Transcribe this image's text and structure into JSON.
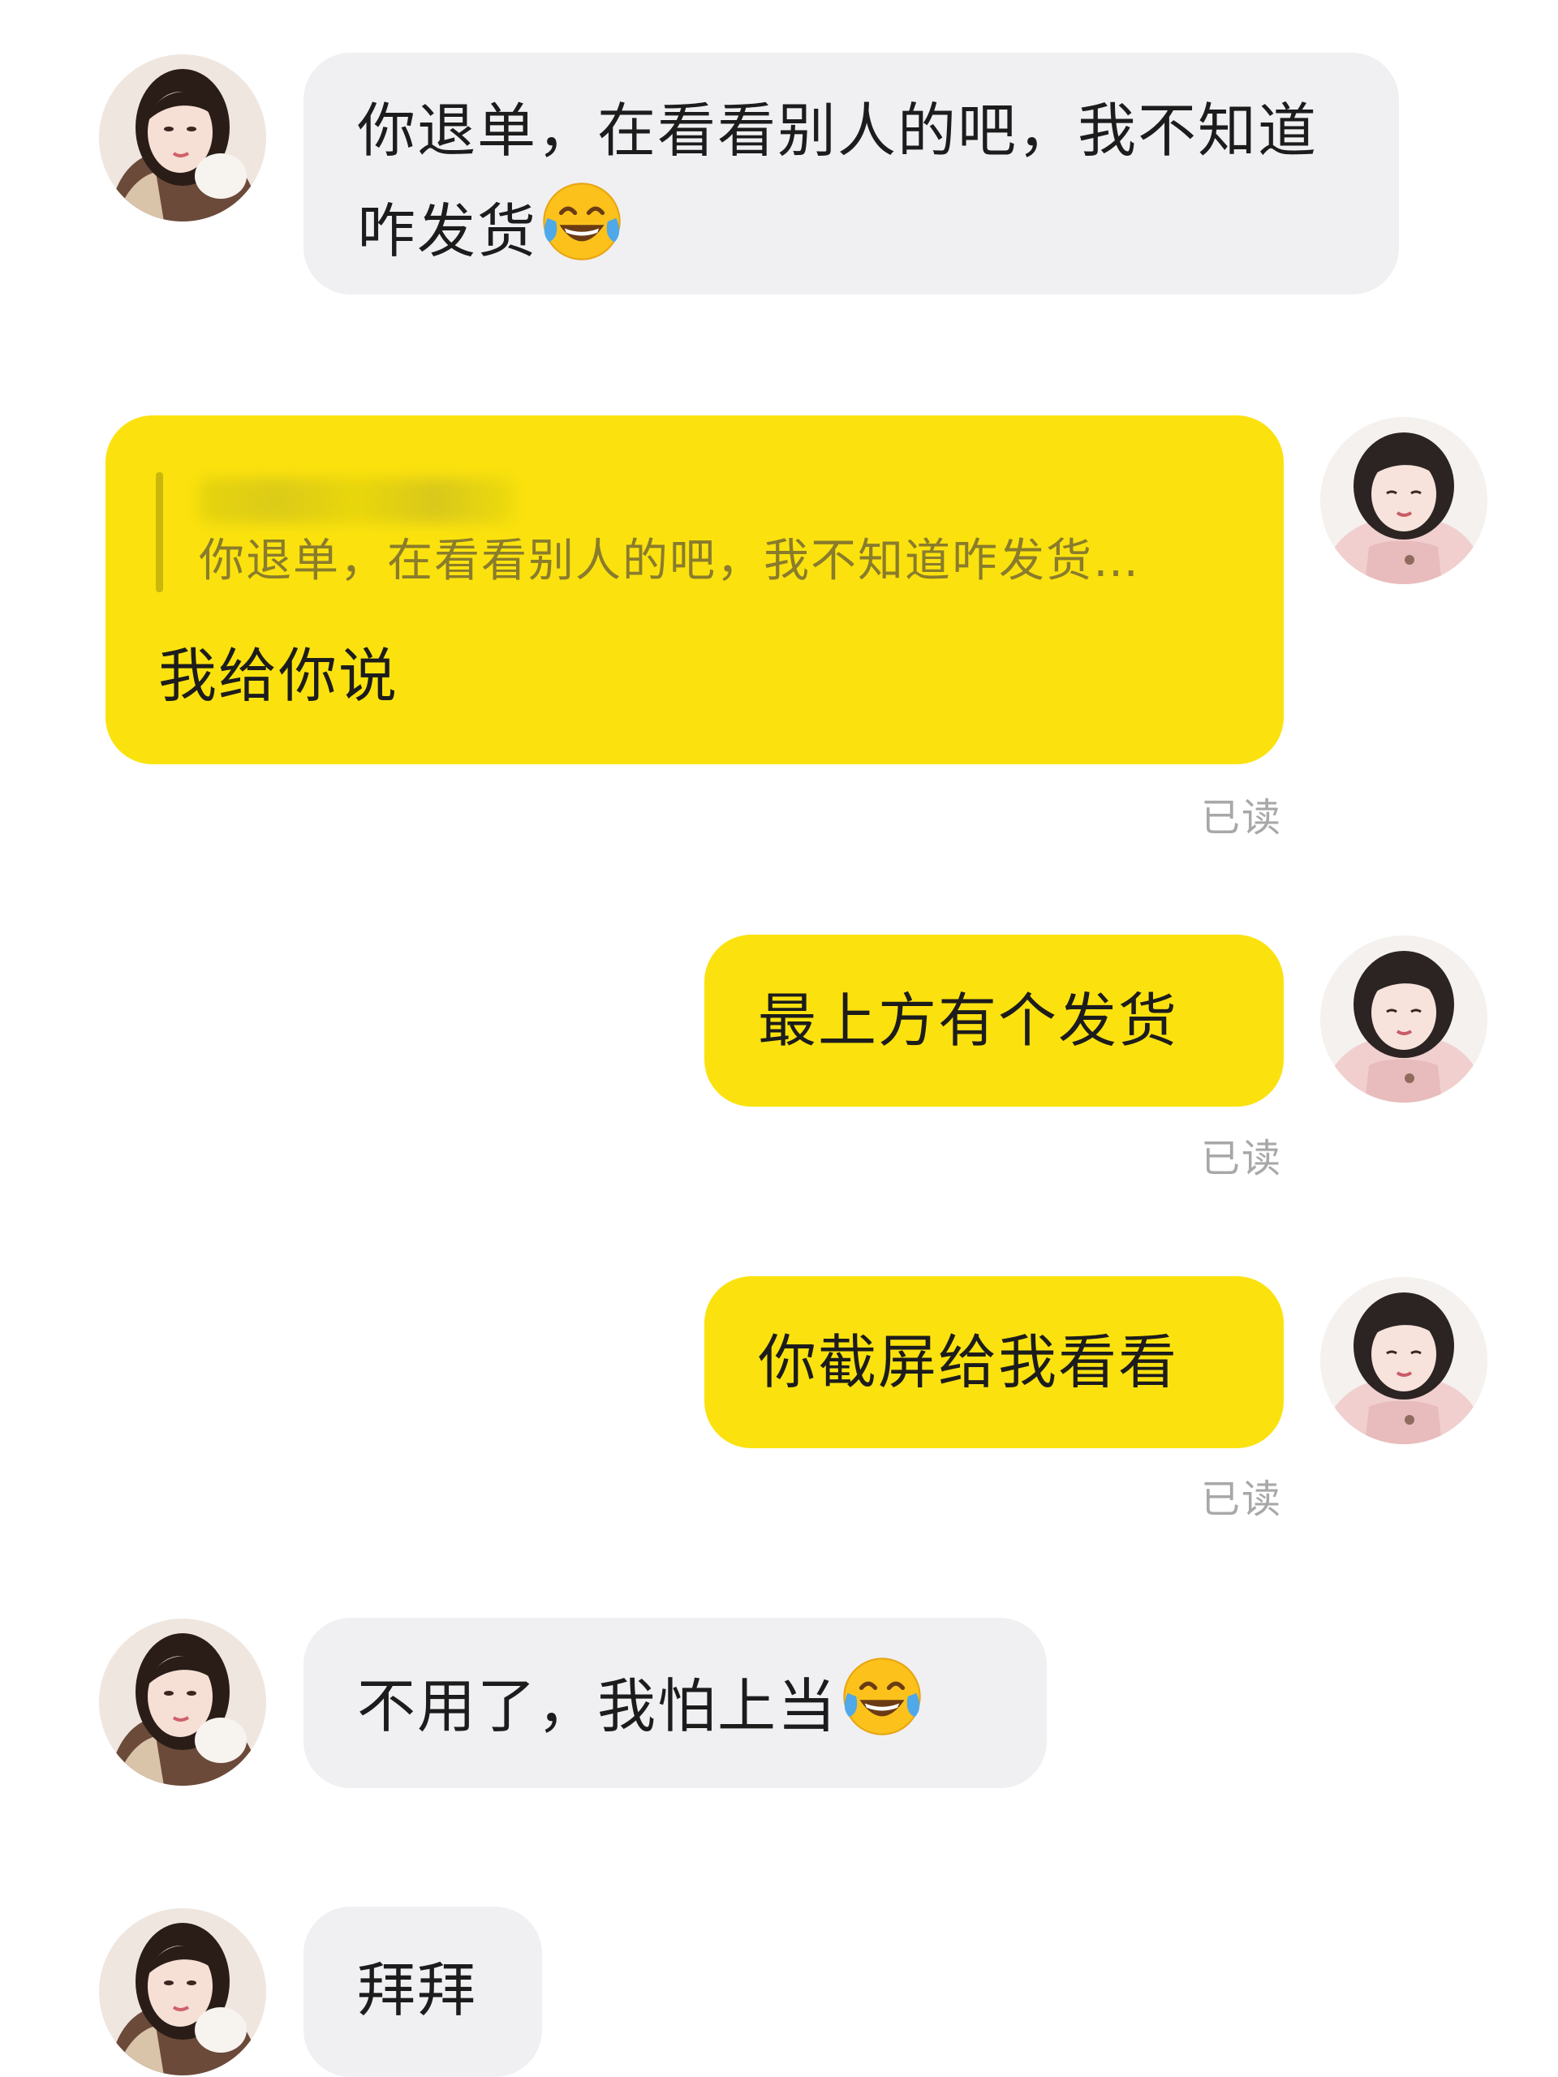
{
  "messages": [
    {
      "side": "incoming",
      "text": "你退单，在看看别人的吧，我不知道咋发货",
      "emoji": "face-with-tears-of-joy"
    },
    {
      "side": "outgoing",
      "quote_text": "你退单，在看看别人的吧，我不知道咋发货…",
      "text": "我给你说",
      "status": "已读"
    },
    {
      "side": "outgoing",
      "text": "最上方有个发货",
      "status": "已读"
    },
    {
      "side": "outgoing",
      "text": "你截屏给我看看",
      "status": "已读"
    },
    {
      "side": "incoming",
      "text": "不用了，我怕上当",
      "emoji": "face-with-tears-of-joy"
    },
    {
      "side": "incoming",
      "text": "拜拜"
    }
  ],
  "colors": {
    "incoming_bubble": "#f0f0f3",
    "outgoing_bubble": "#fbe20e",
    "read_status": "#a8a8a8",
    "background": "#ffffff"
  }
}
